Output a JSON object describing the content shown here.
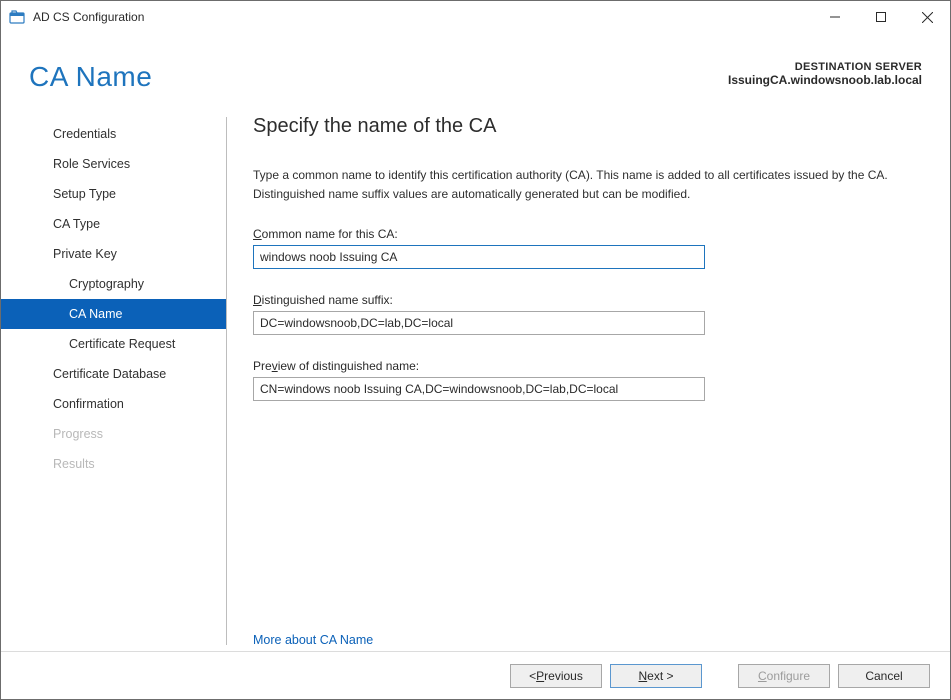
{
  "window": {
    "title": "AD CS Configuration"
  },
  "header": {
    "page_title": "CA Name",
    "dest_label": "DESTINATION SERVER",
    "dest_server": "IssuingCA.windowsnoob.lab.local"
  },
  "sidebar": {
    "items": [
      {
        "label": "Credentials",
        "indent": false,
        "selected": false,
        "disabled": false
      },
      {
        "label": "Role Services",
        "indent": false,
        "selected": false,
        "disabled": false
      },
      {
        "label": "Setup Type",
        "indent": false,
        "selected": false,
        "disabled": false
      },
      {
        "label": "CA Type",
        "indent": false,
        "selected": false,
        "disabled": false
      },
      {
        "label": "Private Key",
        "indent": false,
        "selected": false,
        "disabled": false
      },
      {
        "label": "Cryptography",
        "indent": true,
        "selected": false,
        "disabled": false
      },
      {
        "label": "CA Name",
        "indent": true,
        "selected": true,
        "disabled": false
      },
      {
        "label": "Certificate Request",
        "indent": true,
        "selected": false,
        "disabled": false
      },
      {
        "label": "Certificate Database",
        "indent": false,
        "selected": false,
        "disabled": false
      },
      {
        "label": "Confirmation",
        "indent": false,
        "selected": false,
        "disabled": false
      },
      {
        "label": "Progress",
        "indent": false,
        "selected": false,
        "disabled": true
      },
      {
        "label": "Results",
        "indent": false,
        "selected": false,
        "disabled": true
      }
    ]
  },
  "content": {
    "section_title": "Specify the name of the CA",
    "description": "Type a common name to identify this certification authority (CA). This name is added to all certificates issued by the CA. Distinguished name suffix values are automatically generated but can be modified.",
    "common_name_label_pre": "C",
    "common_name_label_post": "ommon name for this CA:",
    "common_name_value": "windows noob Issuing CA",
    "dn_suffix_label_pre": "D",
    "dn_suffix_label_post": "istinguished name suffix:",
    "dn_suffix_value": "DC=windowsnoob,DC=lab,DC=local",
    "preview_label_pre": "Pre",
    "preview_label_mid": "v",
    "preview_label_post": "iew of distinguished name:",
    "preview_value": "CN=windows noob Issuing CA,DC=windowsnoob,DC=lab,DC=local",
    "more_link": "More about CA Name"
  },
  "buttons": {
    "previous_pre": "< ",
    "previous_u": "P",
    "previous_post": "revious",
    "next_u": "N",
    "next_post": "ext >",
    "configure_u": "C",
    "configure_post": "onfigure",
    "cancel": "Cancel"
  }
}
